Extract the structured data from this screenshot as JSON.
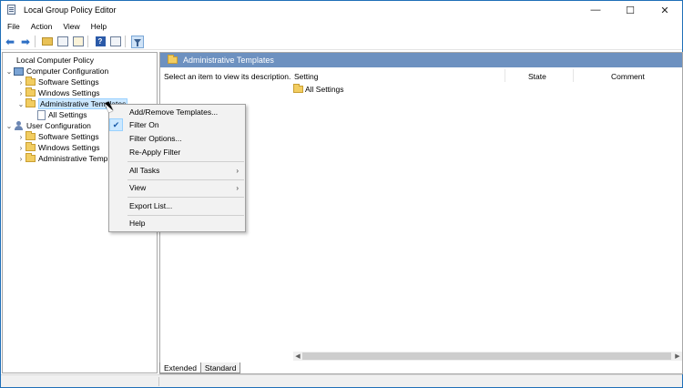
{
  "window": {
    "title": "Local Group Policy Editor"
  },
  "window_controls": {
    "minimize": "—",
    "maximize": "☐",
    "close": "✕"
  },
  "menubar": [
    "File",
    "Action",
    "View",
    "Help"
  ],
  "toolbar": {
    "icons": [
      "back-arrow-icon",
      "forward-arrow-icon",
      "up-folder-icon",
      "show-hide-tree-icon",
      "export-list-icon",
      "help-icon",
      "properties-icon",
      "filter-icon"
    ],
    "back": "⬅",
    "forward": "➡",
    "help": "?"
  },
  "tree": {
    "root": "Local Computer Policy",
    "computer_config": "Computer Configuration",
    "cc_software": "Software Settings",
    "cc_windows": "Windows Settings",
    "cc_admin": "Administrative Templates",
    "cc_all": "All Settings",
    "user_config": "User Configuration",
    "uc_software": "Software Settings",
    "uc_windows": "Windows Settings",
    "uc_admin": "Administrative Temp"
  },
  "right_pane": {
    "header": "Administrative Templates",
    "description": "Select an item to view its description.",
    "columns": {
      "setting": "Setting",
      "state": "State",
      "comment": "Comment"
    },
    "rows": [
      "All Settings"
    ]
  },
  "tabs": [
    "Extended",
    "Standard"
  ],
  "context_menu": {
    "add_remove": "Add/Remove Templates...",
    "filter_on": "Filter On",
    "filter_options": "Filter Options...",
    "reapply": "Re-Apply Filter",
    "all_tasks": "All Tasks",
    "view": "View",
    "export": "Export List...",
    "help": "Help",
    "check": "✔",
    "submenu_arrow": "›"
  }
}
